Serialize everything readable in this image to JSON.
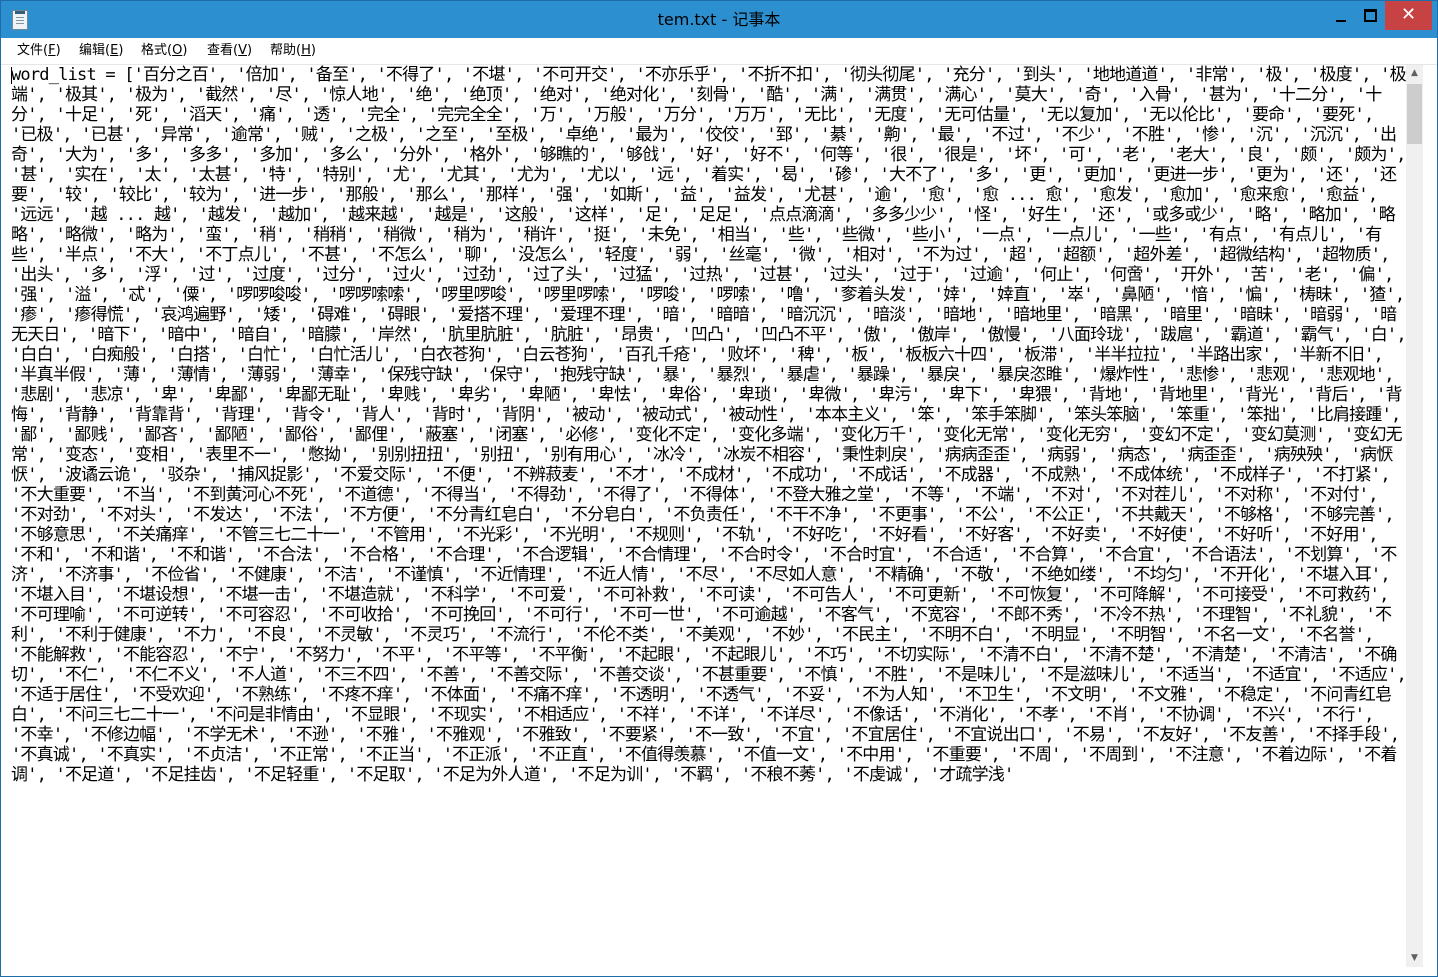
{
  "window": {
    "title": "tem.txt - 记事本",
    "close_glyph": "✕"
  },
  "menu": [
    {
      "label": "文件",
      "accel": "F"
    },
    {
      "label": "编辑",
      "accel": "E"
    },
    {
      "label": "格式",
      "accel": "O"
    },
    {
      "label": "查看",
      "accel": "V"
    },
    {
      "label": "帮助",
      "accel": "H"
    }
  ],
  "editor": {
    "content": "word_list = ['百分之百', '倍加', '备至', '不得了', '不堪', '不可开交', '不亦乐乎', '不折不扣', '彻头彻尾', '充分', '到头', '地地道道', '非常', '极', '极度', '极端', '极其', '极为', '截然', '尽', '惊人地', '绝', '绝顶', '绝对', '绝对化', '刻骨', '酷', '满', '满贯', '满心', '莫大', '奇', '入骨', '甚为', '十二分', '十分', '十足', '死', '滔天', '痛', '透', '完全', '完完全全', '万', '万般', '万分', '万万', '无比', '无度', '无可估量', '无以复加', '无以伦比', '要命', '要死', '已极', '已甚', '异常', '逾常', '贼', '之极', '之至', '至极', '卓绝', '最为', '佼佼', '郅', '綦', '齁', '最', '不过', '不少', '不胜', '惨', '沉', '沉沉', '出奇', '大为', '多', '多多', '多加', '多么', '分外', '格外', '够瞧的', '够戗', '好', '好不', '何等', '很', '很是', '坏', '可', '老', '老大', '良', '颇', '颇为', '甚', '实在', '太', '太甚', '特', '特别', '尤', '尤其', '尤为', '尤以', '远', '着实', '曷', '碜', '大不了', '多', '更', '更加', '更进一步', '更为', '还', '还要', '较', '较比', '较为', '进一步', '那般', '那么', '那样', '强', '如斯', '益', '益发', '尤甚', '逾', '愈', '愈 ... 愈', '愈发', '愈加', '愈来愈', '愈益', '远远', '越 ... 越', '越发', '越加', '越来越', '越是', '这般', '这样', '足', '足足', '点点滴滴', '多多少少', '怪', '好生', '还', '或多或少', '略', '略加', '略略', '略微', '略为', '蛮', '稍', '稍稍', '稍微', '稍为', '稍许', '挺', '未免', '相当', '些', '些微', '些小', '一点', '一点儿', '一些', '有点', '有点儿', '有些', '半点', '不大', '不丁点儿', '不甚', '不怎么', '聊', '没怎么', '轻度', '弱', '丝毫', '微', '相对', '不为过', '超', '超额', '超外差', '超微结构', '超物质', '出头', '多', '浮', '过', '过度', '过分', '过火', '过劲', '过了头', '过猛', '过热', '过甚', '过头', '过于', '过逾', '何止', '何啻', '开外', '苦', '老', '偏', '强', '溢', '忒', '僳', '啰啰唆唆', '啰啰嗦嗦', '啰里啰唆', '啰里啰嗦', '啰唆', '啰嗦', '噜', '奓着头发', '婞', '婞直', '崒', '鼻陋', '愔', '惼', '梼昧', '猹', '瘆', '瘆得慌', '哀鸿遍野', '矮', '碍难', '碍眼', '爱搭不理', '爱理不理', '暗', '暗暗', '暗沉沉', '暗淡', '暗地', '暗地里', '暗黑', '暗里', '暗昧', '暗弱', '暗无天日', '暗下', '暗中', '暗自', '暗朦', '岸然', '肮里肮脏', '肮脏', '昂贵', '凹凸', '凹凸不平', '傲', '傲岸', '傲慢', '八面玲珑', '跋扈', '霸道', '霸气', '白', '白白', '白痴般', '白搭', '白忙', '白忙活儿', '白衣苍狗', '白云苍狗', '百孔千疮', '败坏', '稗', '板', '板板六十四', '板滞', '半半拉拉', '半路出家', '半新不旧', '半真半假', '薄', '薄情', '薄弱', '薄幸', '保残守缺', '保守', '抱残守缺', '暴', '暴烈', '暴虐', '暴躁', '暴戾', '暴戾恣睢', '爆炸性', '悲惨', '悲观', '悲观地', '悲剧', '悲凉', '卑', '卑鄙', '卑鄙无耻', '卑贱', '卑劣', '卑陋', '卑怯', '卑俗', '卑琐', '卑微', '卑污', '卑下', '卑猥', '背地', '背地里', '背光', '背后', '背悔', '背静', '背靠背', '背理', '背令', '背人', '背时', '背阴', '被动', '被动式', '被动性', '本本主义', '笨', '笨手笨脚', '笨头笨脑', '笨重', '笨拙', '比肩接踵', '鄙', '鄙贱', '鄙吝', '鄙陋', '鄙俗', '鄙俚', '蔽塞', '闭塞', '必修', '变化不定', '变化多端', '变化万千', '变化无常', '变化无穷', '变幻不定', '变幻莫测', '变幻无常', '变态', '变相', '表里不一', '憋拗', '别别扭扭', '别扭', '别有用心', '冰冷', '冰炭不相容', '秉性刺戾', '病病歪歪', '病弱', '病态', '病歪歪', '病殃殃', '病恹恹', '波谲云诡', '驳杂', '捕风捉影', '不爱交际', '不便', '不辨菽麦', '不才', '不成材', '不成功', '不成话', '不成器', '不成熟', '不成体统', '不成样子', '不打紧', '不大重要', '不当', '不到黄河心不死', '不道德', '不得当', '不得劲', '不得了', '不得体', '不登大雅之堂', '不等', '不端', '不对', '不对茬儿', '不对称', '不对付', '不对劲', '不对头', '不发达', '不法', '不方便', '不分青红皂白', '不分皂白', '不负责任', '不干不净', '不更事', '不公', '不公正', '不共戴天', '不够格', '不够完善', '不够意思', '不关痛痒', '不管三七二十一', '不管用', '不光彩', '不光明', '不规则', '不轨', '不好吃', '不好看', '不好客', '不好卖', '不好使', '不好听', '不好用', '不和', '不和谐', '不和谐', '不合法', '不合格', '不合理', '不合逻辑', '不合情理', '不合时令', '不合时宜', '不合适', '不合算', '不合宜', '不合语法', '不划算', '不济', '不济事', '不俭省', '不健康', '不洁', '不谨慎', '不近情理', '不近人情', '不尽', '不尽如人意', '不精确', '不敬', '不绝如缕', '不均匀', '不开化', '不堪入耳', '不堪入目', '不堪设想', '不堪一击', '不堪造就', '不科学', '不可爱', '不可补救', '不可读', '不可告人', '不可更新', '不可恢复', '不可降解', '不可接受', '不可救药', '不可理喻', '不可逆转', '不可容忍', '不可收拾', '不可挽回', '不可行', '不可一世', '不可逾越', '不客气', '不宽容', '不郎不秀', '不冷不热', '不理智', '不礼貌', '不利', '不利于健康', '不力', '不良', '不灵敏', '不灵巧', '不流行', '不伦不类', '不美观', '不妙', '不民主', '不明不白', '不明显', '不明智', '不名一文', '不名誉', '不能解救', '不能容忍', '不宁', '不努力', '不平', '不平等', '不平衡', '不起眼', '不起眼儿', '不巧', '不切实际', '不清不白', '不清不楚', '不清楚', '不清洁', '不确切', '不仁', '不仁不义', '不人道', '不三不四', '不善', '不善交际', '不善交谈', '不甚重要', '不慎', '不胜', '不是味儿', '不是滋味儿', '不适当', '不适宜', '不适应', '不适于居住', '不受欢迎', '不熟练', '不疼不痒', '不体面', '不痛不痒', '不透明', '不透气', '不妥', '不为人知', '不卫生', '不文明', '不文雅', '不稳定', '不问青红皂白', '不问三七二十一', '不问是非情由', '不显眼', '不现实', '不相适应', '不祥', '不详', '不详尽', '不像话', '不消化', '不孝', '不肖', '不协调', '不兴', '不行', '不幸', '不修边幅', '不学无术', '不逊', '不雅', '不雅观', '不雅致', '不要紧', '不一致', '不宜', '不宜居住', '不宜说出口', '不易', '不友好', '不友善', '不择手段', '不真诚', '不真实', '不贞洁', '不正常', '不正当', '不正派', '不正直', '不值得羡慕', '不值一文', '不中用', '不重要', '不周', '不周到', '不注意', '不着边际', '不着调', '不足道', '不足挂齿', '不足轻重', '不足取', '不足为外人道', '不足为训', '不羁', '不稂不莠', '不虔诚', '才疏学浅'"
  }
}
